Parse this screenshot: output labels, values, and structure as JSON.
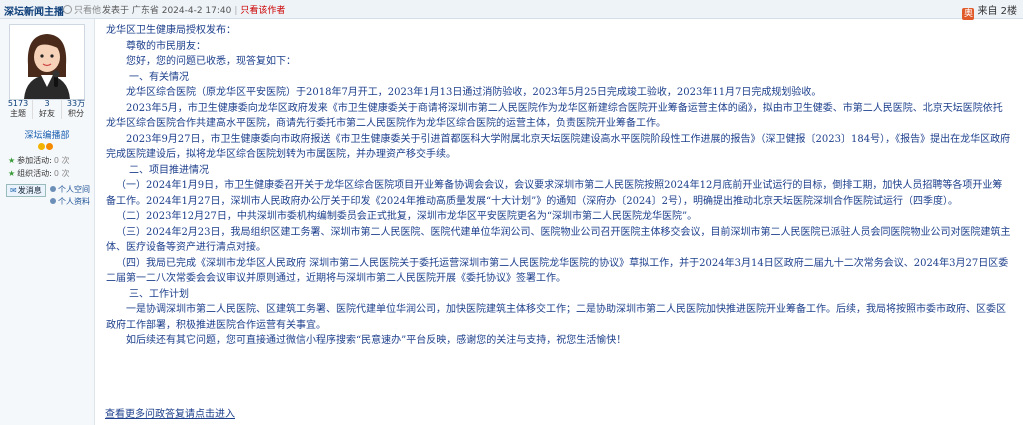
{
  "topbar": {
    "author": "深坛新闻主播",
    "print": "只看他",
    "posted": "发表于 广东省 2024-4-2 17:40",
    "only_author": "只看该作者",
    "client": "来自 2楼",
    "client_badge": "奥"
  },
  "profile": {
    "stats": [
      {
        "value": "5173",
        "label": "主题"
      },
      {
        "value": "3",
        "label": "好友"
      },
      {
        "value": "33万",
        "label": "积分"
      }
    ],
    "role": "深坛编播部",
    "activities": [
      {
        "label": "参加活动:",
        "count": "0 次"
      },
      {
        "label": "组织活动:",
        "count": "0 次"
      }
    ],
    "message_btn": "发消息",
    "space_link": "个人空间",
    "profile_link": "个人资料"
  },
  "content": {
    "paragraphs": [
      {
        "text": "龙华区卫生健康局授权发布：",
        "indent": ""
      },
      {
        "text": "尊敬的市民朋友：",
        "indent": "ind2"
      },
      {
        "text": "您好，您的问题已收悉，现答复如下：",
        "indent": "ind2"
      },
      {
        "text": "一、有关情况",
        "indent": "ind3"
      },
      {
        "text": "龙华区综合医院（原龙华区平安医院）于2018年7月开工，2023年1月13日通过消防验收，2023年5月25日完成竣工验收，2023年11月7日完成规划验收。",
        "indent": "ind2"
      },
      {
        "text": "2023年5月，市卫生健康委向龙华区政府发来《市卫生健康委关于商请将深圳市第二人民医院作为龙华区新建综合医院开业筹备运营主体的函》，拟由市卫生健委、市第二人民医院、北京天坛医院依托龙华区综合医院合作共建高水平医院，商请先行委托市第二人民医院作为龙华区综合医院的运营主体，负责医院开业筹备工作。",
        "indent": "ind2"
      },
      {
        "text": "2023年9月27日，市卫生健康委向市政府报送《市卫生健康委关于引进首都医科大学附属北京天坛医院建设高水平医院阶段性工作进展的报告》（深卫健报〔2023〕184号），《报告》提出在龙华区政府完成医院建设后，拟将龙华区综合医院划转为市属医院，并办理资产移交手续。",
        "indent": "ind2"
      },
      {
        "text": "二、项目推进情况",
        "indent": "ind3"
      },
      {
        "text": "（一）2024年1月9日，市卫生健康委召开关于龙华区综合医院项目开业筹备协调会会议，会议要求深圳市第二人民医院按照2024年12月底前开业试运行的目标，倒排工期，加快人员招聘等各项开业筹备工作。2024年1月27日，深圳市人民政府办公厅关于印发《2024年推动高质量发展“十大计划”》的通知（深府办〔2024〕2号），明确提出推动北京天坛医院深圳合作医院试运行（四季度）。",
        "indent": "ind1"
      },
      {
        "text": "（二）2023年12月27日，中共深圳市委机构编制委员会正式批复，深圳市龙华区平安医院更名为“深圳市第二人民医院龙华医院”。",
        "indent": "ind1"
      },
      {
        "text": "（三）2024年2月23日，我局组织区建工务署、深圳市第二人民医院、医院代建单位华润公司、医院物业公司召开医院主体移交会议，目前深圳市第二人民医院已派驻人员会同医院物业公司对医院建筑主体、医疗设备等资产进行清点对接。",
        "indent": "ind1"
      },
      {
        "text": "（四）我局已完成《深圳市龙华区人民政府 深圳市第二人民医院关于委托运营深圳市第二人民医院龙华医院的协议》草拟工作，并于2024年3月14日区政府二届九十二次常务会议、2024年3月27日区委二届第一二八次常委会会议审议并原则通过，近期将与深圳市第二人民医院开展《委托协议》签署工作。",
        "indent": "ind1"
      },
      {
        "text": "三、工作计划",
        "indent": "ind3"
      },
      {
        "text": "一是协调深圳市第二人民医院、区建筑工务署、医院代建单位华润公司，加快医院建筑主体移交工作；二是协助深圳市第二人民医院加快推进医院开业筹备工作。后续，我局将按照市委市政府、区委区政府工作部署，积极推进医院合作运营有关事宜。",
        "indent": "ind2"
      },
      {
        "text": "如后续还有其它问题，您可直接通过微信小程序搜索“民意速办”平台反映，感谢您的关注与支持，祝您生活愉快！",
        "indent": "ind2"
      }
    ],
    "more_link": "查看更多问政答复请点击进入"
  },
  "colors": {
    "text": "#1d3f8c",
    "accent": "#0b3d78",
    "sidebar_bg": "#f5f8fb",
    "topbar_bg": "#eef3f8",
    "only_author": "#cc0000"
  }
}
